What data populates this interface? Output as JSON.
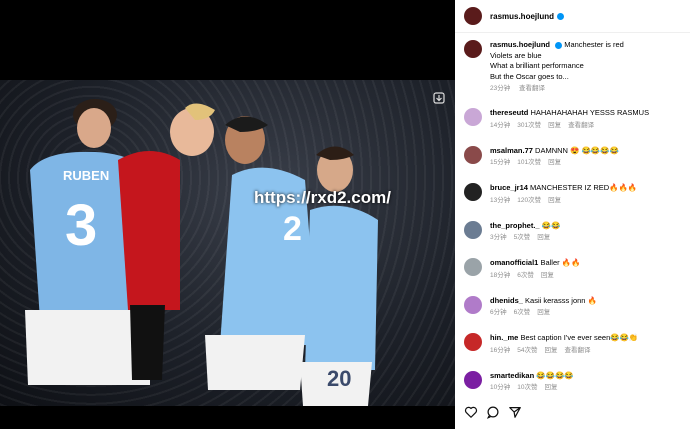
{
  "post": {
    "username": "rasmus.hoejlund",
    "watermark": "https://rxd2.com/"
  },
  "caption": {
    "username": "rasmus.hoejlund",
    "lines": [
      "Manchester is red",
      "Violets are blue",
      "What a brilliant performance",
      "But the Oscar goes to..."
    ],
    "time": "23分钟",
    "translate": "查看翻译"
  },
  "comments": [
    {
      "username": "thereseutd",
      "text": "HAHAHAHAHAH YESSS RASMUS",
      "time": "14分钟",
      "likes": "301次赞",
      "reply": "回复",
      "translate": "查看翻译",
      "color": "#c9a7d6"
    },
    {
      "username": "msalman.77",
      "text": "DAMNNN 😍 😂😂😂😂",
      "time": "15分钟",
      "likes": "101次赞",
      "reply": "回复",
      "translate": "",
      "color": "#8a4a4a"
    },
    {
      "username": "bruce_jr14",
      "text": "MANCHESTER IZ RED🔥🔥🔥",
      "time": "13分钟",
      "likes": "120次赞",
      "reply": "回复",
      "translate": "",
      "color": "#222"
    },
    {
      "username": "the_prophet._",
      "text": "😂😂",
      "time": "3分钟",
      "likes": "5次赞",
      "reply": "回复",
      "translate": "",
      "color": "#6b7c92"
    },
    {
      "username": "omanofficial1",
      "text": "Baller 🔥🔥",
      "time": "18分钟",
      "likes": "6次赞",
      "reply": "回复",
      "translate": "",
      "color": "#9aa3a8"
    },
    {
      "username": "dhenids_",
      "text": "Kasii kerasss jonn 🔥",
      "time": "6分钟",
      "likes": "6次赞",
      "reply": "回复",
      "translate": "",
      "color": "#b07bc9"
    },
    {
      "username": "hin._me",
      "text": "Best caption I've ever seen😂😂👏",
      "time": "16分钟",
      "likes": "54次赞",
      "reply": "回复",
      "translate": "查看翻译",
      "color": "#c62828"
    },
    {
      "username": "smartedikan",
      "text": "😂😂😂😂",
      "time": "10分钟",
      "likes": "10次赞",
      "reply": "回复",
      "translate": "",
      "color": "#7b1fa2"
    }
  ]
}
